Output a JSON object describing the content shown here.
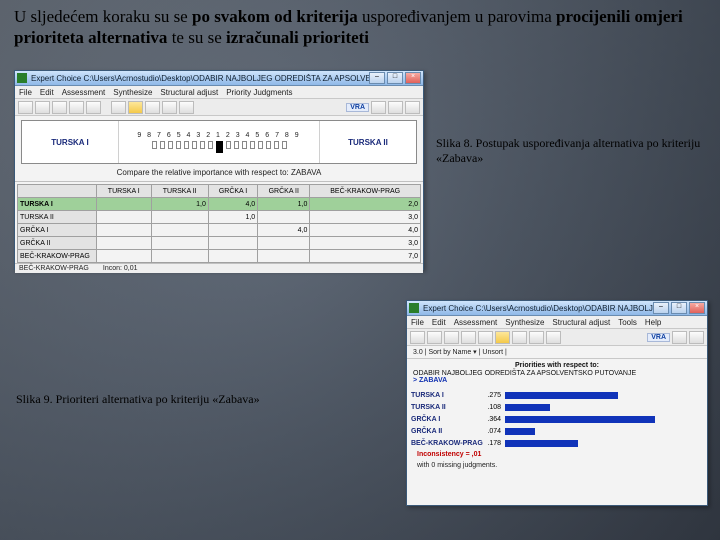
{
  "heading": {
    "p1": "U sljedećem koraku su se ",
    "b1": "po svakom od kriterija",
    "p2": " uspoređivanjem u parovima ",
    "b2": "procijenili omjeri prioriteta alternativa",
    "p3": " te su se ",
    "b3": "izračunali prioriteti"
  },
  "fig8": {
    "title": "Expert Choice   C:\\Users\\Acrnostudio\\Desktop\\ODABIR NAJBOLJEG ODREDIŠTA ZA APSOLVENTSKO PUTOVANJE.AHP",
    "menu": [
      "File",
      "Edit",
      "Assessment",
      "Synthesize",
      "Structural adjust",
      "Priority Judgments"
    ],
    "toolbar_badge": "VRA",
    "pair_left": "TURSKA I",
    "pair_right": "TURSKA II",
    "scale": "9 8 7 6 5 4 3 2 1 2 3 4 5 6 7 8 9",
    "compare_line": "Compare the relative importance with respect to: ZABAVA",
    "table": {
      "headers": [
        "",
        "TURSKA I",
        "TURSKA II",
        "GRČKA I",
        "GRČKA II",
        "BEČ-KRAKOW-PRAG"
      ],
      "rows": [
        {
          "name": "TURSKA I",
          "c": [
            "",
            "1,0",
            "4,0",
            "1,0",
            "2,0"
          ],
          "hl": true
        },
        {
          "name": "TURSKA II",
          "c": [
            "",
            "",
            "1,0",
            "",
            "3,0"
          ],
          "hl": false
        },
        {
          "name": "GRČKA I",
          "c": [
            "",
            "",
            "",
            "4,0",
            "4,0"
          ],
          "hl": false
        },
        {
          "name": "GRČKA II",
          "c": [
            "",
            "",
            "",
            "",
            "3,0"
          ],
          "hl": false
        },
        {
          "name": "BEČ-KRAKOW-PRAG",
          "c": [
            "",
            "",
            "",
            "",
            "7,0"
          ],
          "hl": false
        }
      ]
    },
    "status_left": "BEČ-KRAKOW-PRAG",
    "status_right": "Incon: 0,01"
  },
  "caption8": "Slika 8. Postupak uspoređivanja alternativa po kriteriju «Zabava»",
  "fig9": {
    "title": "Expert Choice   C:\\Users\\Acrnostudio\\Desktop\\ODABIR NAJBOLJEG ODREDIŠTA ZA APSOLVENTSKO PUTOVANJE.AHP",
    "menu": [
      "File",
      "Edit",
      "Assessment",
      "Synthesize",
      "Structural adjust",
      "Tools",
      "Help"
    ],
    "toolbar_badge": "VRA",
    "sub": "3.0  |  Sort by Name  ▾  |  Unsort  |",
    "header": "Priorities with respect to:",
    "crit_line1": "ODABIR NAJBOLJEG ODREDIŠTA ZA APSOLVENTSKO PUTOVANJE",
    "crit_line2": "> ZABAVA",
    "rows": [
      {
        "name": "TURSKA I",
        "val": ".275"
      },
      {
        "name": "TURSKA II",
        "val": ".108"
      },
      {
        "name": "GRČKA I",
        "val": ".364"
      },
      {
        "name": "GRČKA II",
        "val": ".074"
      },
      {
        "name": "BEČ-KRAKOW-PRAG",
        "val": ".178"
      }
    ],
    "foot1": "Inconsistency = ,01",
    "foot2": "      with 0 missing judgments."
  },
  "caption9": "Slika 9. Prioriteri alternativa po kriteriju «Zabava»"
}
